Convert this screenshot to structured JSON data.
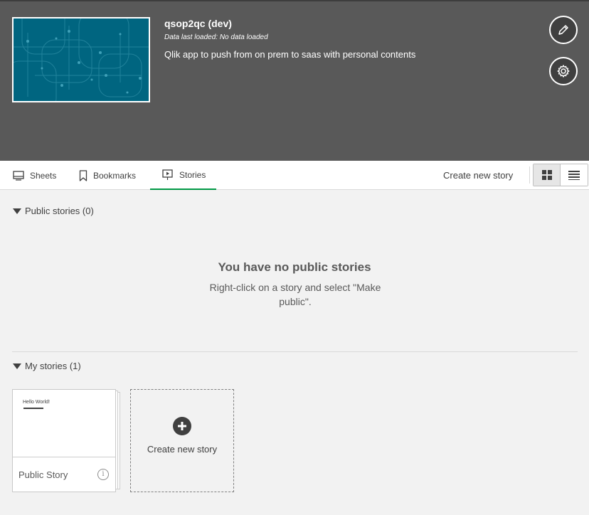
{
  "app": {
    "title": "qsop2qc (dev)",
    "data_loaded": "Data last loaded: No data loaded",
    "description": "Qlik app to push from on prem to saas with personal contents",
    "edit_icon": "pencil-icon",
    "settings_icon": "gear-icon"
  },
  "tabs": [
    {
      "label": "Sheets",
      "icon": "sheets-icon",
      "active": false
    },
    {
      "label": "Bookmarks",
      "icon": "bookmark-icon",
      "active": false
    },
    {
      "label": "Stories",
      "icon": "story-icon",
      "active": true
    }
  ],
  "toolbar": {
    "create_new_story": "Create new story",
    "view_mode": "grid"
  },
  "public_section": {
    "header": "Public stories (0)",
    "empty_title": "You have no public stories",
    "empty_desc": "Right-click on a story and select \"Make public\"."
  },
  "my_section": {
    "header": "My stories (1)",
    "stories": [
      {
        "title": "Public Story",
        "preview_text": "Hello World!"
      }
    ],
    "create_label": "Create new story"
  },
  "colors": {
    "header_bg": "#595959",
    "active_tab": "#009845",
    "thumbnail": "#006580"
  }
}
